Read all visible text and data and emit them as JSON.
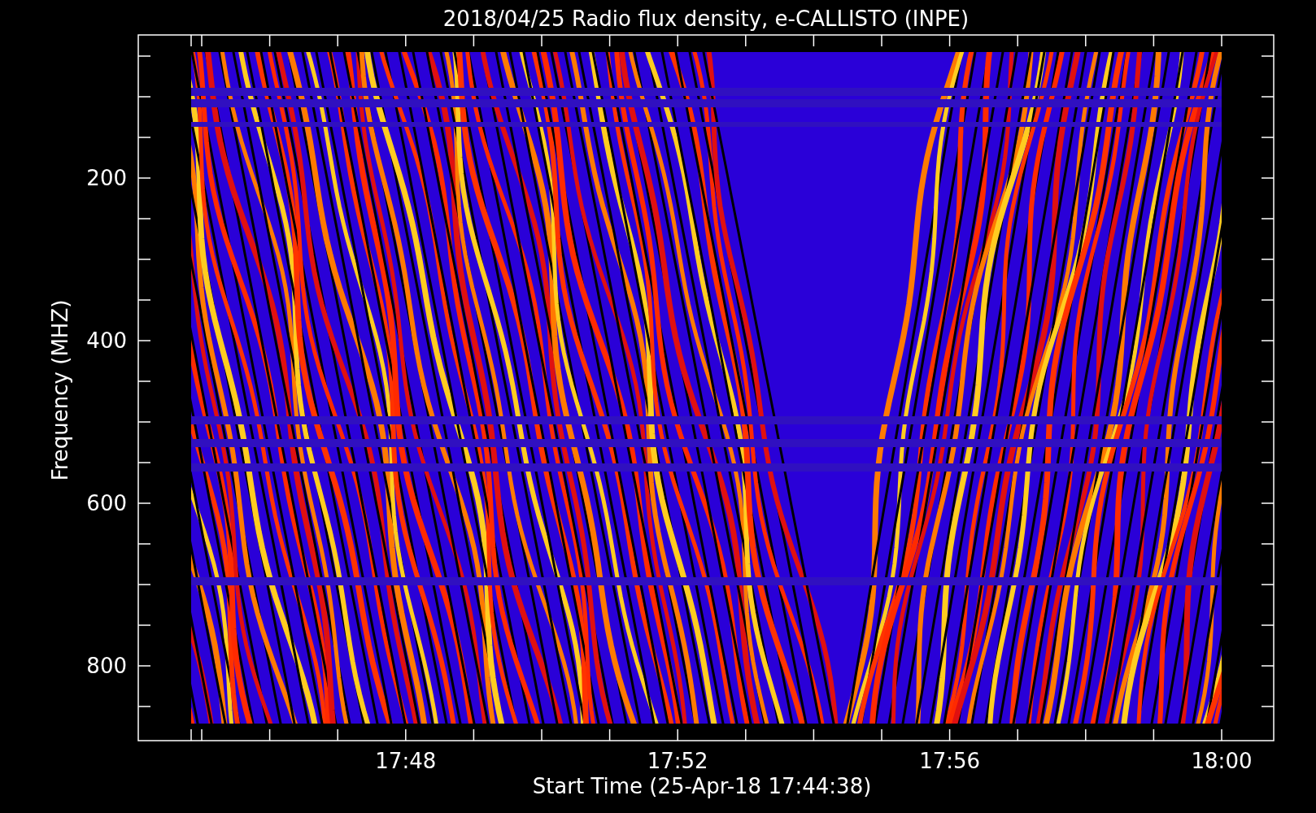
{
  "title": "2018/04/25  Radio flux density, e-CALLISTO (INPE)",
  "y_axis": {
    "label": "Frequency (MHZ)",
    "ticks": [
      "200",
      "400",
      "600",
      "800"
    ]
  },
  "x_axis": {
    "label": "Start Time (25-Apr-18 17:44:38)",
    "ticks": [
      "17:48",
      "17:52",
      "17:56",
      "18:00"
    ]
  }
}
